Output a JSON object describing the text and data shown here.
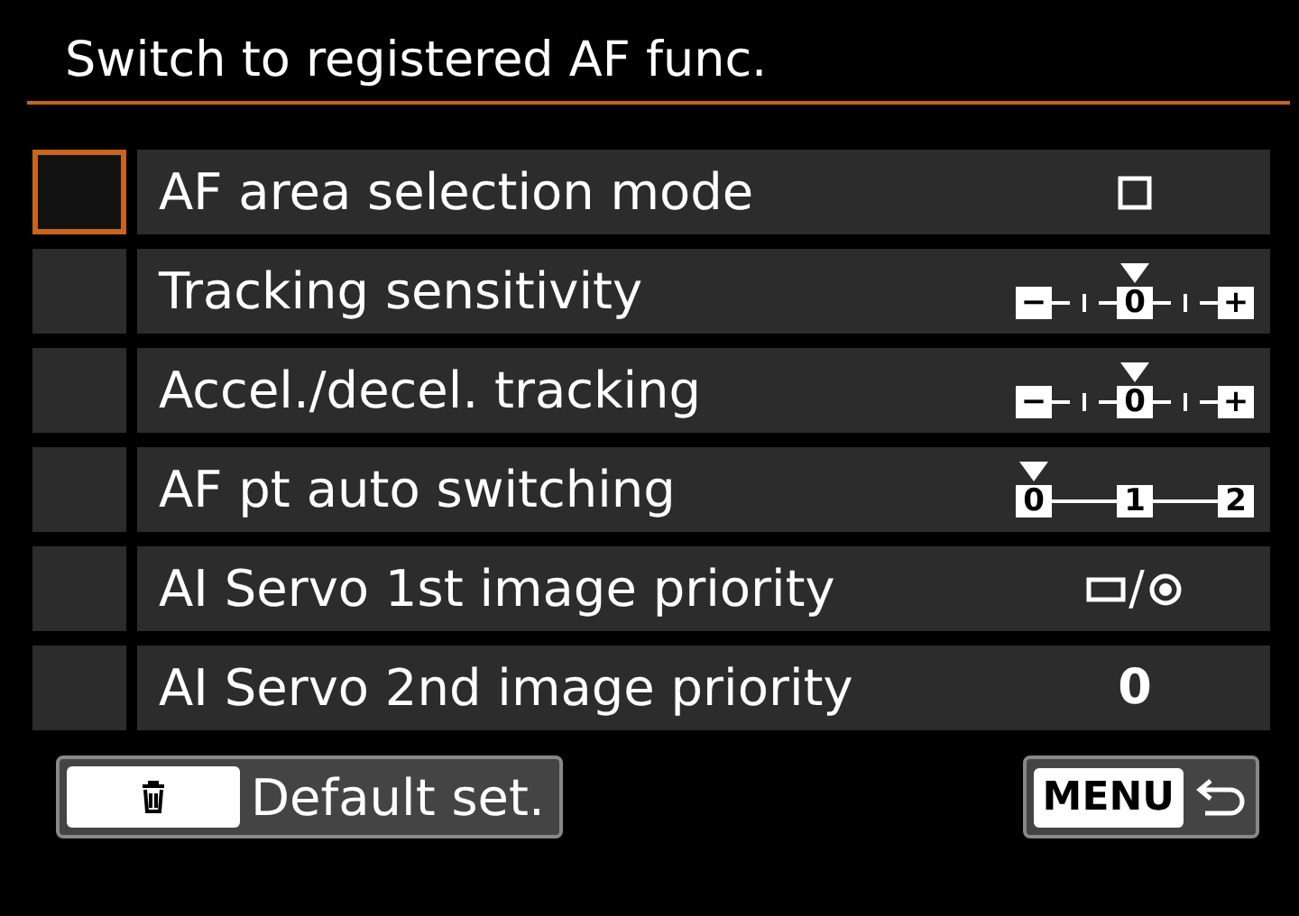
{
  "title": "Switch to registered AF func.",
  "rows": [
    {
      "label": "AF area selection mode",
      "selected": true,
      "checked": false,
      "value": {
        "kind": "square-icon"
      }
    },
    {
      "label": "Tracking sensitivity",
      "selected": false,
      "checked": false,
      "value": {
        "kind": "scale",
        "stops": [
          {
            "kind": "box",
            "label": "−",
            "selected": false
          },
          {
            "kind": "tick",
            "selected": false
          },
          {
            "kind": "box",
            "label": "0",
            "selected": true
          },
          {
            "kind": "tick",
            "selected": false
          },
          {
            "kind": "box",
            "label": "+",
            "selected": false
          }
        ]
      }
    },
    {
      "label": "Accel./decel. tracking",
      "selected": false,
      "checked": false,
      "value": {
        "kind": "scale",
        "stops": [
          {
            "kind": "box",
            "label": "−",
            "selected": false
          },
          {
            "kind": "tick",
            "selected": false
          },
          {
            "kind": "box",
            "label": "0",
            "selected": true
          },
          {
            "kind": "tick",
            "selected": false
          },
          {
            "kind": "box",
            "label": "+",
            "selected": false
          }
        ]
      }
    },
    {
      "label": "AF pt auto switching",
      "selected": false,
      "checked": false,
      "value": {
        "kind": "scale",
        "stops": [
          {
            "kind": "box",
            "label": "0",
            "selected": true
          },
          {
            "kind": "box",
            "label": "1",
            "selected": false
          },
          {
            "kind": "box",
            "label": "2",
            "selected": false
          }
        ]
      }
    },
    {
      "label": "AI Servo 1st image priority",
      "selected": false,
      "checked": false,
      "value": {
        "kind": "mode-icon",
        "text": "/"
      }
    },
    {
      "label": "AI Servo 2nd image priority",
      "selected": false,
      "checked": false,
      "value": {
        "kind": "text",
        "text": "0"
      }
    }
  ],
  "footer": {
    "default_button": "Default set.",
    "menu_key": "MENU"
  }
}
